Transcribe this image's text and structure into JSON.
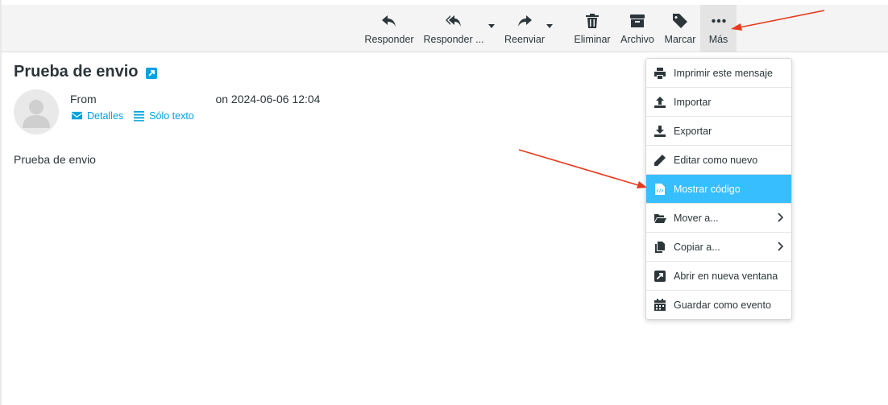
{
  "toolbar": {
    "buttons": [
      {
        "label": "Responder",
        "icon": "reply-icon"
      },
      {
        "label": "Responder ...",
        "icon": "reply-all-icon"
      },
      {
        "label": "Reenviar",
        "icon": "forward-icon"
      },
      {
        "label": "Eliminar",
        "icon": "trash-icon"
      },
      {
        "label": "Archivo",
        "icon": "archive-box-icon"
      },
      {
        "label": "Marcar",
        "icon": "tag-icon"
      },
      {
        "label": "Más",
        "icon": "more-dots-icon"
      }
    ]
  },
  "message": {
    "subject": "Prueba de envio",
    "from_label": "From",
    "date_text": "on 2024-06-06 12:04",
    "details_link": "Detalles",
    "plaintext_link": "Sólo texto",
    "body": "Prueba de envio"
  },
  "menu": {
    "items": [
      {
        "label": "Imprimir este mensaje",
        "icon": "printer-icon"
      },
      {
        "label": "Importar",
        "icon": "upload-icon"
      },
      {
        "label": "Exportar",
        "icon": "download-icon"
      },
      {
        "label": "Editar como nuevo",
        "icon": "pencil-icon"
      },
      {
        "label": "Mostrar código",
        "icon": "code-file-icon",
        "selected": true
      },
      {
        "label": "Mover a...",
        "icon": "folder-open-icon",
        "submenu": true
      },
      {
        "label": "Copiar a...",
        "icon": "copy-icon",
        "submenu": true
      },
      {
        "label": "Abrir en nueva ventana",
        "icon": "external-window-icon"
      },
      {
        "label": "Guardar como evento",
        "icon": "calendar-icon"
      }
    ]
  },
  "colors": {
    "accent": "#00a3e0",
    "selected_item": "#37beff",
    "annotation_arrow": "#e8391d",
    "toolbar_bg": "#f4f4f4"
  }
}
